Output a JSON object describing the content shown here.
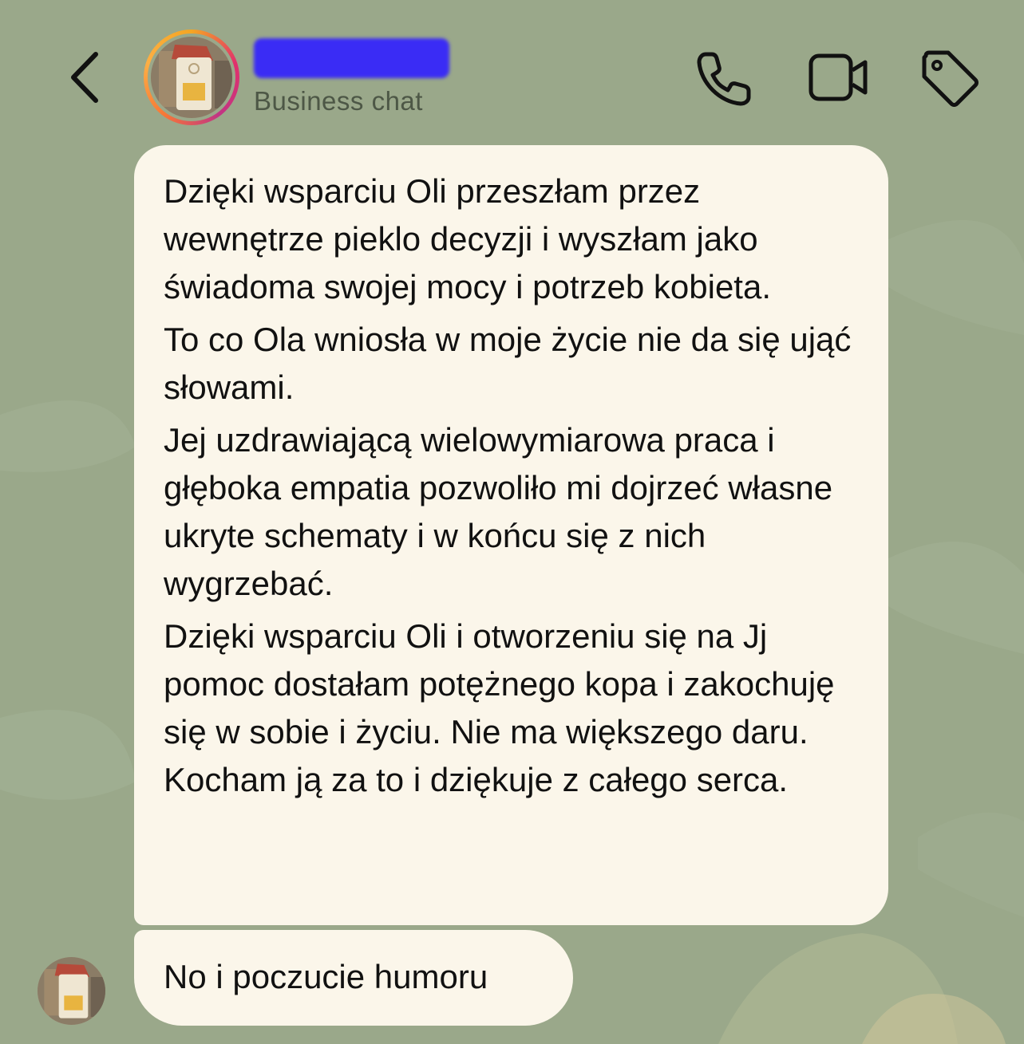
{
  "header": {
    "back_label": "Back",
    "contact_name": "",
    "subtitle": "Business chat",
    "actions": {
      "call": "phone-icon",
      "video": "video-camera-icon",
      "label": "tag-icon"
    }
  },
  "messages": [
    {
      "sender": "business",
      "paragraphs": [
        "Dzięki wsparciu Oli przeszłam przez wewnętrze pieklo decyzji i wyszłam jako świadoma swojej mocy i potrzeb kobieta.",
        "To co Ola wniosła w moje życie nie da się ująć słowami.",
        "Jej uzdrawiającą wielowymiarowa praca i głęboka empatia pozwoliło mi dojrzeć własne ukryte schematy i w końcu się z nich wygrzebać.",
        "Dzięki wsparciu Oli i otworzeniu się na Jj pomoc dostałam potężnego kopa i zakochuję się w sobie i życiu. Nie ma większego daru. Kocham ją za to i dziękuje z całego serca."
      ]
    },
    {
      "sender": "business",
      "text": "No i poczucie humoru"
    }
  ],
  "colors": {
    "background": "#9aa88a",
    "bubble": "#fbf6ea",
    "redaction": "#3a2cf5",
    "text": "#111111",
    "subtitle": "#4d5746"
  }
}
